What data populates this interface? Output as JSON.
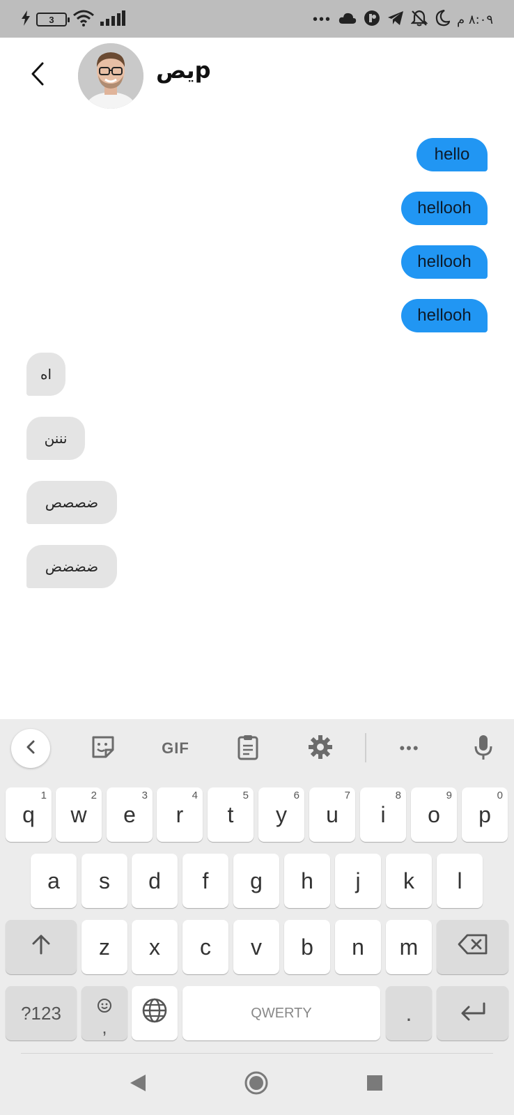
{
  "status_bar": {
    "battery_level": "3",
    "time": "٨:٠٩ م",
    "dots": "•••",
    "icons": [
      "charging-icon",
      "battery-icon",
      "wifi-icon",
      "signal-icon",
      "cloud-icon",
      "app-icon",
      "telegram-icon",
      "mute-bell-icon",
      "moon-icon"
    ]
  },
  "header": {
    "contact_name": "يصp",
    "avatar_alt": "contact avatar"
  },
  "messages": [
    {
      "direction": "out",
      "text": "hello"
    },
    {
      "direction": "out",
      "text": "hellooh"
    },
    {
      "direction": "out",
      "text": "hellooh"
    },
    {
      "direction": "out",
      "text": "hellooh"
    },
    {
      "direction": "in",
      "text": "اه"
    },
    {
      "direction": "in",
      "text": "نننن"
    },
    {
      "direction": "in",
      "text": "ضصصص"
    },
    {
      "direction": "in",
      "text": "ضضضض"
    }
  ],
  "keyboard": {
    "toolbar": {
      "gif_label": "GIF",
      "more_label": "•••",
      "icons": [
        "chevron-left-icon",
        "sticker-icon",
        "clipboard-icon",
        "gear-icon",
        "microphone-icon"
      ]
    },
    "row1": [
      {
        "label": "q",
        "hint": "1"
      },
      {
        "label": "w",
        "hint": "2"
      },
      {
        "label": "e",
        "hint": "3"
      },
      {
        "label": "r",
        "hint": "4"
      },
      {
        "label": "t",
        "hint": "5"
      },
      {
        "label": "y",
        "hint": "6"
      },
      {
        "label": "u",
        "hint": "7"
      },
      {
        "label": "i",
        "hint": "8"
      },
      {
        "label": "o",
        "hint": "9"
      },
      {
        "label": "p",
        "hint": "0"
      }
    ],
    "row2": [
      "a",
      "s",
      "d",
      "f",
      "g",
      "h",
      "j",
      "k",
      "l"
    ],
    "row3": [
      "z",
      "x",
      "c",
      "v",
      "b",
      "n",
      "m"
    ],
    "row4": {
      "symbols_label": "?123",
      "comma_label": ",",
      "space_label": "QWERTY",
      "period_label": "."
    },
    "accent_color": "#2196f3"
  },
  "nav_bar": {
    "icons": [
      "back-triangle-icon",
      "home-circle-icon",
      "recents-square-icon"
    ]
  }
}
